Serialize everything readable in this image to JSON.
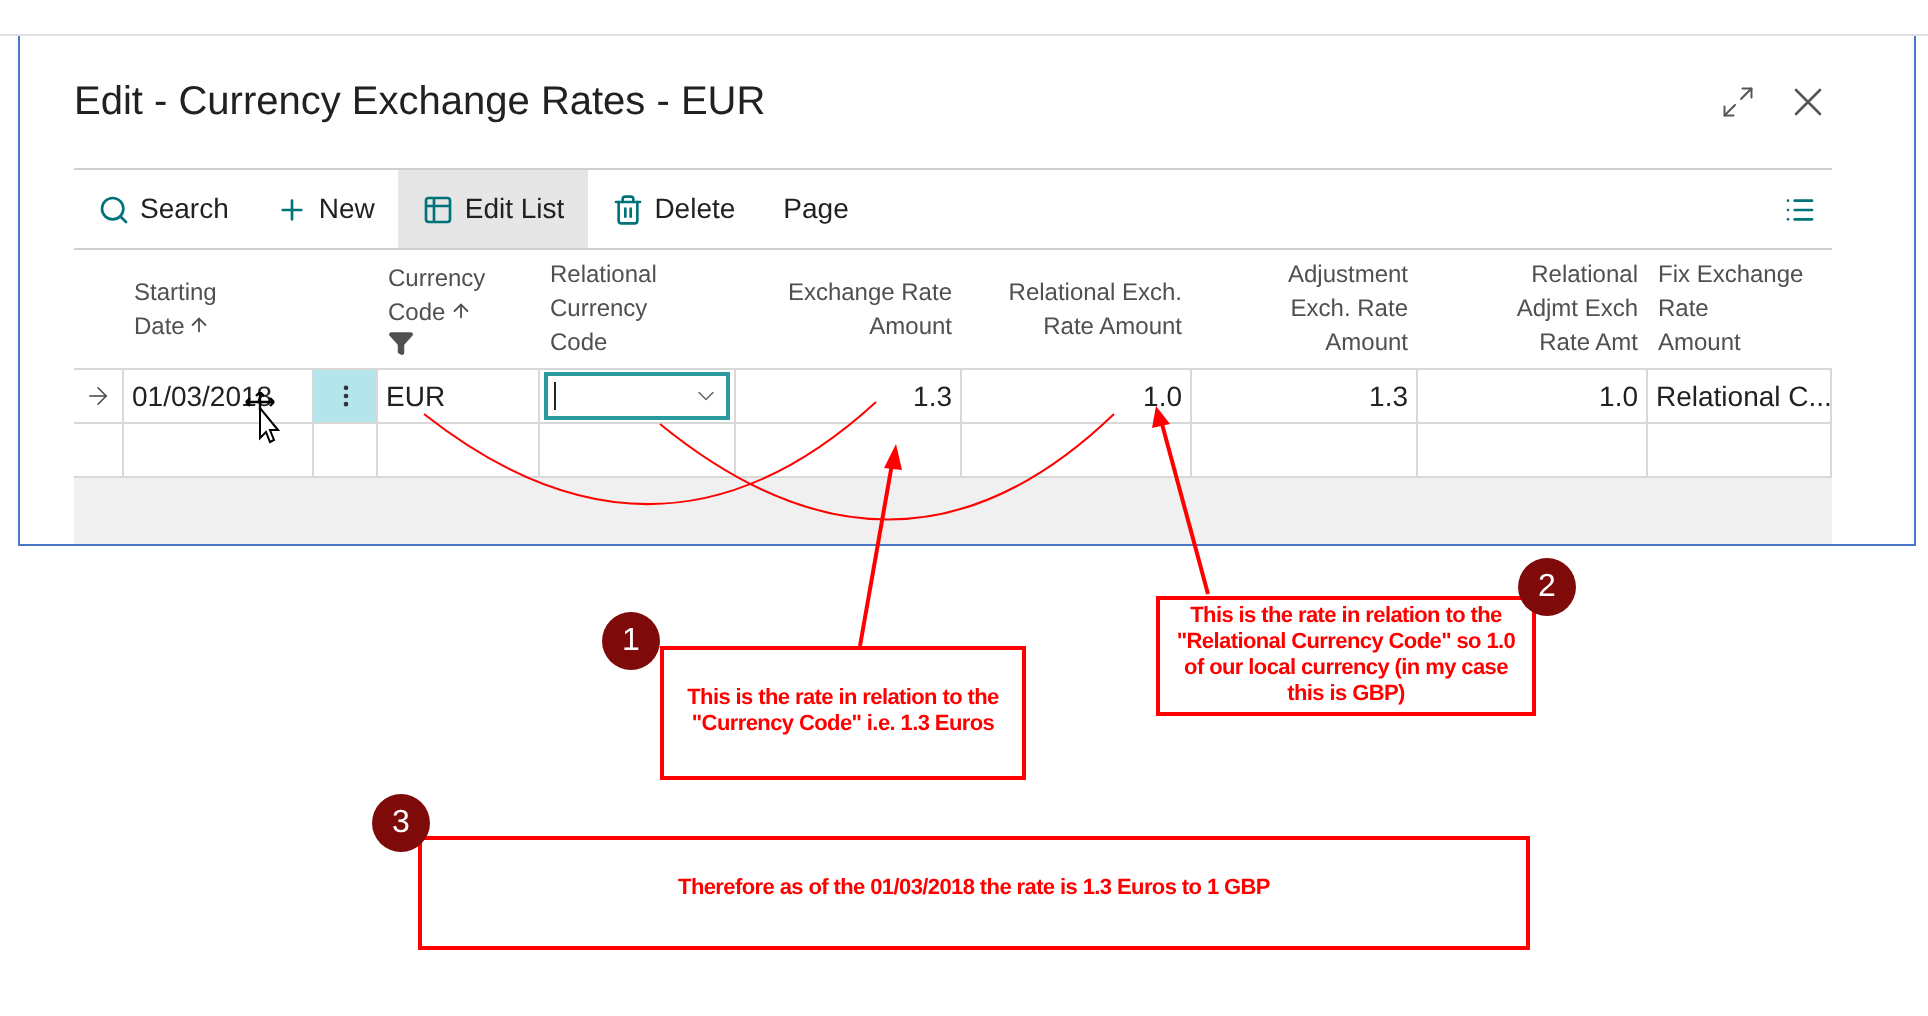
{
  "window": {
    "title": "Edit - Currency Exchange Rates - EUR"
  },
  "toolbar": [
    {
      "kind": "search",
      "label": "Search",
      "selected": false
    },
    {
      "kind": "new",
      "label": "New",
      "selected": false
    },
    {
      "kind": "edit-list",
      "label": "Edit List",
      "selected": true
    },
    {
      "kind": "delete",
      "label": "Delete",
      "selected": false
    },
    {
      "kind": "plain",
      "label": "Page",
      "selected": false
    }
  ],
  "table": {
    "columns": [
      {
        "label": [
          "Starting",
          "Date"
        ],
        "sorted": true,
        "filtered": false
      },
      {
        "label": [
          "Currency",
          "Code"
        ],
        "sorted": true,
        "filtered": true
      },
      {
        "label": [
          "Relational",
          "Currency",
          "Code"
        ],
        "sorted": false,
        "filtered": false
      },
      {
        "label": [
          "Exchange Rate",
          "Amount"
        ],
        "sorted": false,
        "filtered": false
      },
      {
        "label": [
          "Relational Exch.",
          "Rate Amount"
        ],
        "sorted": false,
        "filtered": false
      },
      {
        "label": [
          "Adjustment",
          "Exch. Rate",
          "Amount"
        ],
        "sorted": false,
        "filtered": false
      },
      {
        "label": [
          "Relational",
          "Adjmt Exch",
          "Rate Amt"
        ],
        "sorted": false,
        "filtered": false
      },
      {
        "label": [
          "Fix Exchange",
          "Rate",
          "Amount"
        ],
        "sorted": false,
        "filtered": false
      }
    ],
    "rows": [
      {
        "current": true,
        "cells": [
          "01/03/2018",
          "EUR",
          "",
          "1.3",
          "1.0",
          "1.3",
          "1.0",
          "Relational C..."
        ]
      }
    ]
  },
  "annotations": [
    {
      "number": "1",
      "text": "This is the rate in relation to the \"Currency Code\" i.e. 1.3 Euros"
    },
    {
      "number": "2",
      "text": "This is the rate in relation to the \"Relational Currency Code\" so 1.0 of our local currency (in my case this is GBP)"
    },
    {
      "number": "3",
      "text": "Therefore as of the 01/03/2018 the rate is 1.3 Euros to 1 GBP"
    }
  ]
}
